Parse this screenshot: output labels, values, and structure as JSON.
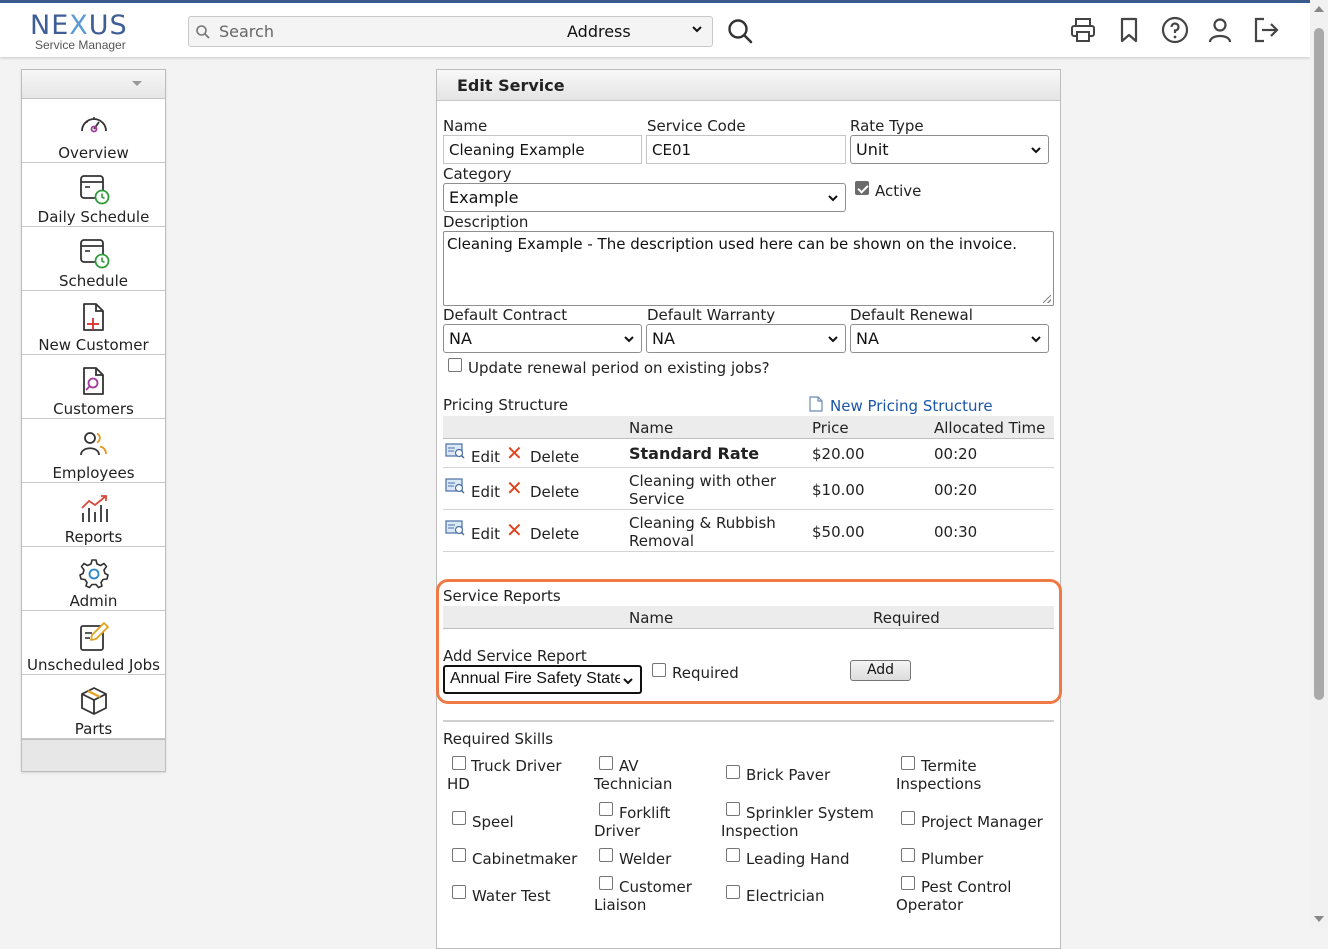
{
  "logo": {
    "brand_pre": "NE",
    "brand_x": "X",
    "brand_post": "US",
    "subtitle": "Service Manager"
  },
  "search": {
    "placeholder": "Search",
    "scope": "Address"
  },
  "header_icons": [
    "printer-icon",
    "bookmark-icon",
    "help-icon",
    "user-icon",
    "logout-icon"
  ],
  "sidebar": {
    "items": [
      {
        "label": "Overview",
        "icon": "speedometer-icon"
      },
      {
        "label": "Daily Schedule",
        "icon": "calendar-clock-icon"
      },
      {
        "label": "Schedule",
        "icon": "calendar-clock-icon"
      },
      {
        "label": "New Customer",
        "icon": "add-document-icon"
      },
      {
        "label": "Customers",
        "icon": "search-document-icon"
      },
      {
        "label": "Employees",
        "icon": "people-icon"
      },
      {
        "label": "Reports",
        "icon": "chart-icon"
      },
      {
        "label": "Admin",
        "icon": "gear-icon"
      },
      {
        "label": "Unscheduled Jobs",
        "icon": "edit-list-icon"
      },
      {
        "label": "Parts",
        "icon": "box-icon"
      }
    ]
  },
  "form": {
    "title": "Edit Service",
    "name_label": "Name",
    "name_value": "Cleaning Example",
    "code_label": "Service Code",
    "code_value": "CE01",
    "rate_label": "Rate Type",
    "rate_value": "Unit",
    "category_label": "Category",
    "category_value": "Example",
    "active_label": "Active",
    "active_checked": true,
    "description_label": "Description",
    "description_value": "Cleaning Example - The description used here can be shown on the invoice.",
    "contract_label": "Default Contract",
    "contract_value": "NA",
    "warranty_label": "Default Warranty",
    "warranty_value": "NA",
    "renewal_label": "Default Renewal",
    "renewal_value": "NA",
    "update_renewal_label": "Update renewal period on existing jobs?"
  },
  "pricing": {
    "title": "Pricing Structure",
    "new_link": "New Pricing Structure",
    "headers": {
      "name": "Name",
      "price": "Price",
      "time": "Allocated Time"
    },
    "edit_label": "Edit",
    "delete_label": "Delete",
    "rows": [
      {
        "name": "Standard Rate",
        "price": "$20.00",
        "time": "00:20",
        "bold": true
      },
      {
        "name": "Cleaning with other Service",
        "price": "$10.00",
        "time": "00:20",
        "bold": false
      },
      {
        "name": "Cleaning & Rubbish Removal",
        "price": "$50.00",
        "time": "00:30",
        "bold": false
      }
    ]
  },
  "service_reports": {
    "title": "Service Reports",
    "headers": {
      "name": "Name",
      "required": "Required"
    },
    "add_label": "Add Service Report",
    "select_value": "Annual Fire Safety Statement",
    "required_label": "Required",
    "add_button": "Add"
  },
  "skills": {
    "title": "Required Skills",
    "items": [
      "Truck Driver HD",
      "AV Technician",
      "Brick Paver",
      "Termite Inspections",
      "Speel",
      "Forklift Driver",
      "Sprinkler System Inspection",
      "Project Manager",
      "Cabinetmaker",
      "Welder",
      "Leading Hand",
      "Plumber",
      "Water Test",
      "Customer Liaison",
      "Electrician",
      "Pest Control Operator"
    ]
  },
  "colors": {
    "accent": "#3f5e96",
    "link": "#1a56a8",
    "highlight": "#f07a46",
    "delete": "#e0441f"
  }
}
